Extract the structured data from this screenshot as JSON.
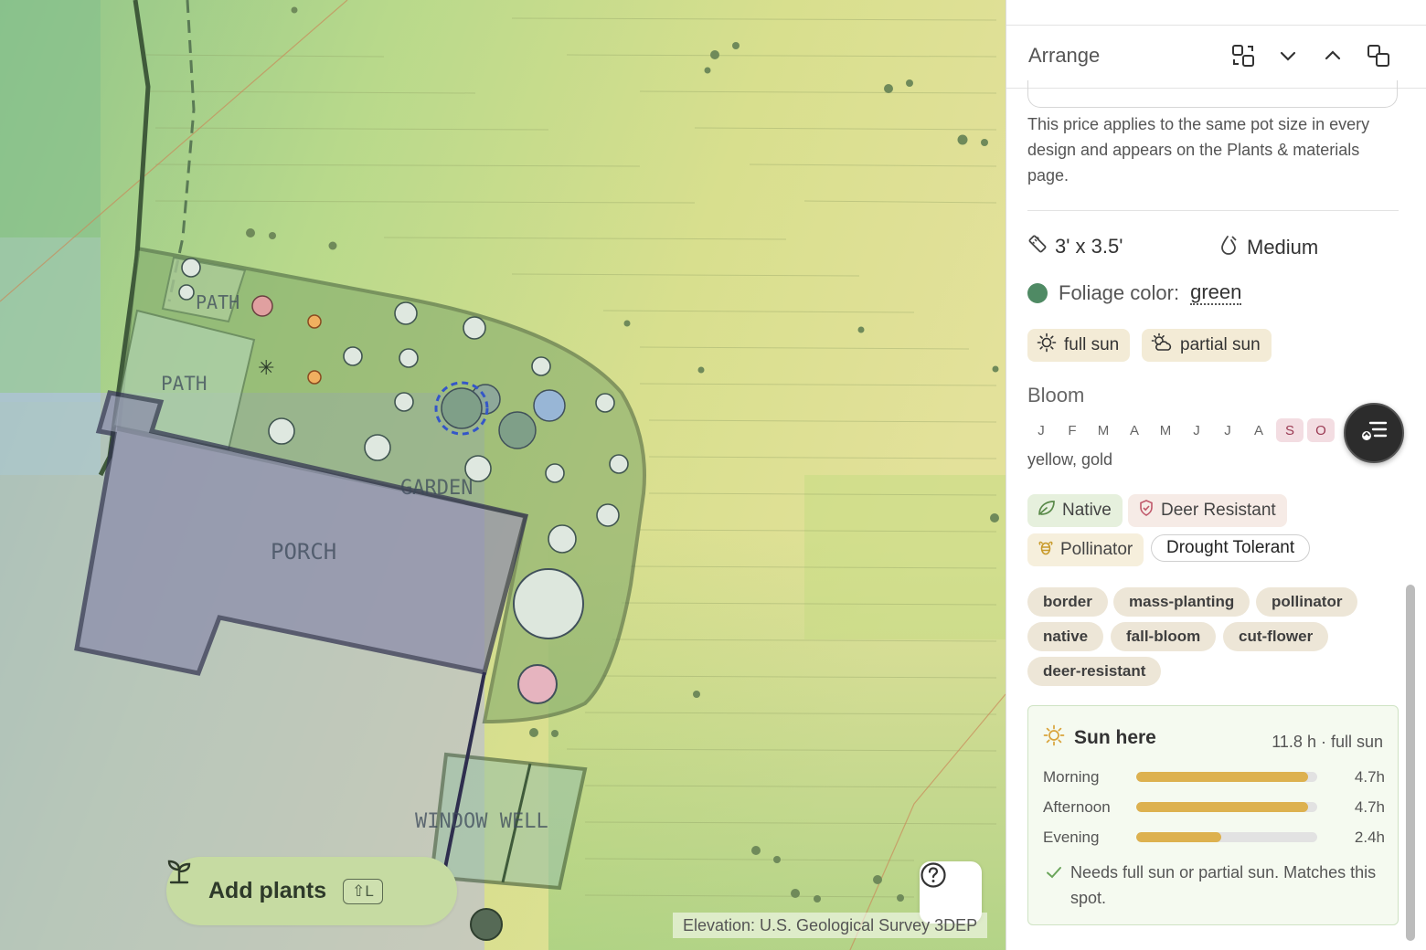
{
  "map": {
    "labels": {
      "path_top": "PATH",
      "path": "PATH",
      "garden": "GARDEN",
      "porch": "PORCH",
      "window_well": "WINDOW WELL"
    },
    "add_plants": {
      "label": "Add plants",
      "shortcut": "⇧L",
      "icon": "sprout-icon"
    },
    "help_icon": "question-circle-icon",
    "attribution": "Elevation: U.S. Geological Survey 3DEP"
  },
  "panel": {
    "header": {
      "title": "Arrange",
      "icons": [
        "bring-to-front-icon",
        "chevron-down-icon",
        "chevron-up-icon",
        "send-to-back-icon"
      ]
    },
    "price_note": "This price applies to the same pot size in every design and appears on the Plants & materials page.",
    "size": {
      "value": "3' x 3.5'",
      "icon": "ruler-icon"
    },
    "water": {
      "value": "Medium",
      "icon": "water-drop-icon"
    },
    "foliage": {
      "label": "Foliage color:",
      "value": "green",
      "color": "#4f8a64"
    },
    "light": [
      {
        "label": "full sun",
        "icon": "sun-icon"
      },
      {
        "label": "partial sun",
        "icon": "partly-cloudy-icon"
      }
    ],
    "bloom": {
      "title": "Bloom",
      "months": [
        {
          "m": "J",
          "on": false
        },
        {
          "m": "F",
          "on": false
        },
        {
          "m": "M",
          "on": false
        },
        {
          "m": "A",
          "on": false
        },
        {
          "m": "M",
          "on": false
        },
        {
          "m": "J",
          "on": false
        },
        {
          "m": "J",
          "on": false
        },
        {
          "m": "A",
          "on": false
        },
        {
          "m": "S",
          "on": true
        },
        {
          "m": "O",
          "on": true
        }
      ],
      "colors": "yellow, gold"
    },
    "attributes": {
      "native": "Native",
      "deer_resistant": "Deer Resistant",
      "pollinator": "Pollinator",
      "drought_tolerant": "Drought Tolerant"
    },
    "tags": [
      "border",
      "mass-planting",
      "pollinator",
      "native",
      "fall-bloom",
      "cut-flower",
      "deer-resistant"
    ],
    "sun_here": {
      "title": "Sun here",
      "total": "11.8 h · full sun",
      "rows": [
        {
          "name": "Morning",
          "hours": "4.7h",
          "fraction": 0.95
        },
        {
          "name": "Afternoon",
          "hours": "4.7h",
          "fraction": 0.95
        },
        {
          "name": "Evening",
          "hours": "2.4h",
          "fraction": 0.47
        }
      ],
      "note": "Needs full sun or partial sun. Matches this spot."
    },
    "colors": {
      "accent_sun": "#ddb14f",
      "bloom_on": "#9b3b54"
    }
  }
}
